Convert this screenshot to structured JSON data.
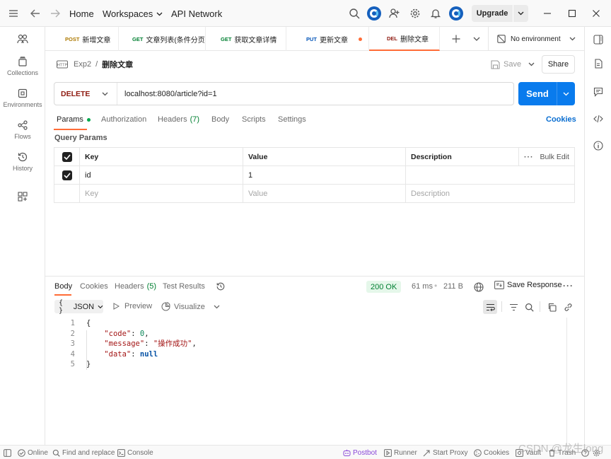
{
  "topbar": {
    "home": "Home",
    "workspaces": "Workspaces",
    "api_network": "API Network",
    "upgrade": "Upgrade"
  },
  "sidebar": {
    "items": [
      {
        "label": "Collections",
        "icon": "collections-icon"
      },
      {
        "label": "Environments",
        "icon": "environments-icon"
      },
      {
        "label": "Flows",
        "icon": "flows-icon"
      },
      {
        "label": "History",
        "icon": "history-icon"
      }
    ]
  },
  "tabs": [
    {
      "method": "POST",
      "label": "新增文章"
    },
    {
      "method": "GET",
      "label": "文章列表(条件分页"
    },
    {
      "method": "GET",
      "label": "获取文章详情"
    },
    {
      "method": "PUT",
      "label": "更新文章"
    },
    {
      "method": "DEL",
      "label": "删除文章"
    }
  ],
  "environment": "No environment",
  "breadcrumb": {
    "collection": "Exp2",
    "separator": "/",
    "request": "删除文章"
  },
  "actions": {
    "save": "Save",
    "share": "Share"
  },
  "request": {
    "method": "DELETE",
    "url": "localhost:8080/article?id=1",
    "send": "Send"
  },
  "request_tabs": {
    "params": "Params",
    "authorization": "Authorization",
    "headers": "Headers",
    "headers_count": "(7)",
    "body": "Body",
    "scripts": "Scripts",
    "settings": "Settings",
    "cookies": "Cookies"
  },
  "query_params": {
    "title": "Query Params",
    "columns": {
      "key": "Key",
      "value": "Value",
      "description": "Description"
    },
    "bulk_edit": "Bulk Edit",
    "rows": [
      {
        "key": "id",
        "value": "1",
        "description": "",
        "checked": true
      }
    ],
    "placeholder": {
      "key": "Key",
      "value": "Value",
      "description": "Description"
    }
  },
  "response": {
    "tabs": {
      "body": "Body",
      "cookies": "Cookies",
      "headers": "Headers",
      "headers_count": "(5)",
      "test_results": "Test Results"
    },
    "status": "200 OK",
    "time": "61 ms",
    "size": "211 B",
    "save_response": "Save Response",
    "format": "JSON",
    "preview": "Preview",
    "visualize": "Visualize",
    "body_lines": [
      {
        "n": "1",
        "text": "{"
      },
      {
        "n": "2",
        "key": "\"code\"",
        "value": "0",
        "type": "num",
        "trail": ","
      },
      {
        "n": "3",
        "key": "\"message\"",
        "value": "\"操作成功\"",
        "type": "str",
        "trail": ","
      },
      {
        "n": "4",
        "key": "\"data\"",
        "value": "null",
        "type": "kw",
        "trail": ""
      },
      {
        "n": "5",
        "text": "}"
      }
    ]
  },
  "statusbar": {
    "online": "Online",
    "find_replace": "Find and replace",
    "console": "Console",
    "postbot": "Postbot",
    "runner": "Runner",
    "start_proxy": "Start Proxy",
    "cookies": "Cookies",
    "vault": "Vault",
    "trash": "Trash"
  },
  "watermark": "CSDN @龙生long",
  "colors": {
    "send": "#097bed",
    "status_ok_bg": "#e5f7ea",
    "status_ok": "#007f31",
    "active_tab_underline": "#ff6c37"
  }
}
